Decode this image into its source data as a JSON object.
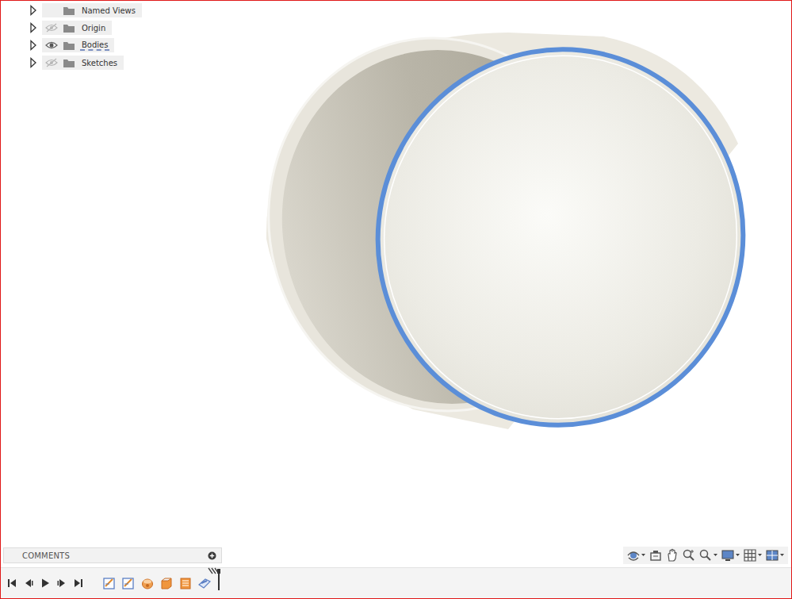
{
  "browser": {
    "items": [
      {
        "label": "Named Views",
        "kind": "plain",
        "expanded": false,
        "visible": true
      },
      {
        "label": "Origin",
        "kind": "eye",
        "expanded": false,
        "visible": false
      },
      {
        "label": "Bodies",
        "kind": "eye",
        "expanded": false,
        "visible": true
      },
      {
        "label": "Sketches",
        "kind": "eye",
        "expanded": false,
        "visible": false
      }
    ]
  },
  "comments": {
    "title": "COMMENTS"
  },
  "timeline": {
    "features": [
      {
        "kind": "sketch"
      },
      {
        "kind": "sketch"
      },
      {
        "kind": "revolve"
      },
      {
        "kind": "extrude"
      },
      {
        "kind": "shell"
      },
      {
        "kind": "split"
      }
    ]
  }
}
